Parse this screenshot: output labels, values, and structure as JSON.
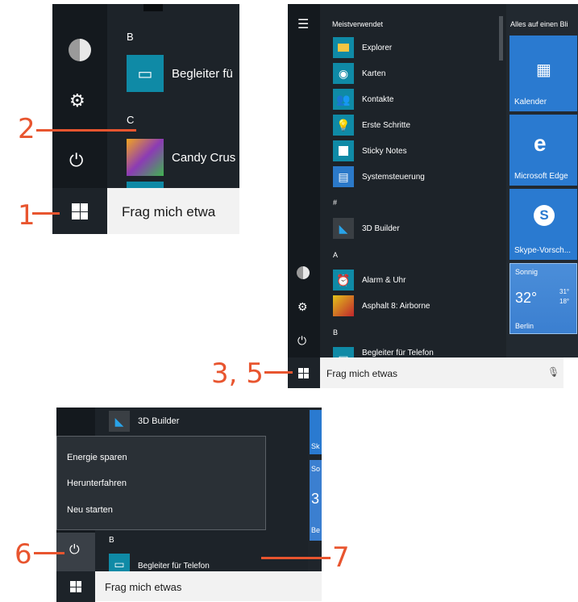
{
  "callouts": [
    "1",
    "2",
    "3, 5",
    "6",
    "7"
  ],
  "panel1": {
    "letters": [
      "B",
      "C"
    ],
    "apps": [
      "Begleiter fü",
      "Candy Crus"
    ],
    "search_placeholder": "Frag mich etwa"
  },
  "panel2": {
    "section_most_used": "Meistverwendet",
    "right_header": "Alles auf einen Bli",
    "most_used": [
      "Explorer",
      "Karten",
      "Kontakte",
      "Erste Schritte",
      "Sticky Notes",
      "Systemsteuerung"
    ],
    "hash_section": "#",
    "hash_apps": [
      "3D Builder"
    ],
    "a_section": "A",
    "a_apps": [
      "Alarm & Uhr",
      "Asphalt 8: Airborne"
    ],
    "b_section": "B",
    "b_apps": [
      "Begleiter für Telefon"
    ],
    "tiles": {
      "calendar": "Kalender",
      "edge": "Microsoft Edge",
      "skype": "Skype-Vorsch...",
      "weather_condition": "Sonnig",
      "weather_temp": "32°",
      "weather_high": "31°",
      "weather_low": "18°",
      "weather_city": "Berlin"
    },
    "search_placeholder": "Frag mich etwas"
  },
  "panel3": {
    "top_app": "3D Builder",
    "power_menu": [
      "Energie sparen",
      "Herunterfahren",
      "Neu starten"
    ],
    "letter": "B",
    "partial_app": "Begleiter für Telefon",
    "search_placeholder": "Frag mich etwas",
    "right_tile_fragments": [
      "Sk",
      "So",
      "3",
      "Be"
    ]
  }
}
